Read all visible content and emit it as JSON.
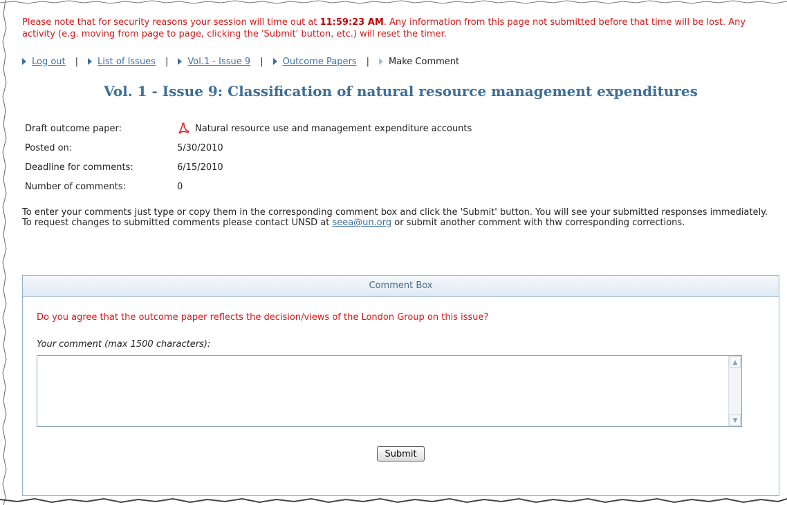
{
  "notice": {
    "before": "Please note that for security reasons your session will time out at ",
    "time": "11:59:23 AM",
    "after": ". Any information from this page not submitted before that time will be lost. Any activity (e.g. moving from page to page, clicking the 'Submit' button, etc.) will reset the timer."
  },
  "breadcrumb": {
    "separator": "|",
    "items": [
      {
        "label": "Log out",
        "link": true
      },
      {
        "label": "List of Issues",
        "link": true
      },
      {
        "label": "Vol.1 - Issue 9",
        "link": true
      },
      {
        "label": "Outcome Papers",
        "link": true
      },
      {
        "label": "Make Comment",
        "link": false
      }
    ]
  },
  "page_title": "Vol. 1 - Issue 9: Classification of natural resource management expenditures",
  "info": {
    "draft_label": "Draft outcome paper:",
    "draft_value": "Natural resource use and management expenditure accounts",
    "draft_icon": "pdf-icon",
    "posted_label": "Posted on:",
    "posted_value": "5/30/2010",
    "deadline_label": "Deadline for comments:",
    "deadline_value": "6/15/2010",
    "count_label": "Number of comments:",
    "count_value": "0"
  },
  "instructions": {
    "before": "To enter your comments just type or copy them in the corresponding comment box and click the 'Submit' button. You will see your submitted responses immediately. To request changes to submitted comments please contact UNSD at ",
    "email": "seea@un.org",
    "after": " or submit another comment with thw corresponding corrections."
  },
  "comment_box": {
    "header": "Comment Box",
    "question": "Do you agree that the outcome paper reflects the decision/views of the London Group on this issue?",
    "comment_label": "Your comment (max 1500 characters):",
    "textarea_value": "",
    "submit_label": "Submit"
  },
  "colors": {
    "notice_red": "#d11b1b",
    "link_blue": "#3b6ea5",
    "title_blue": "#3f6f96",
    "box_border": "#8fb2cf"
  }
}
